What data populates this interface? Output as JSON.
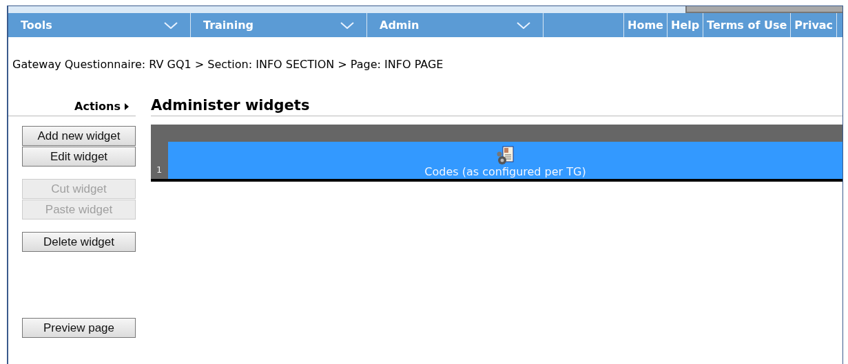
{
  "nav": {
    "menus": [
      {
        "label": "Tools"
      },
      {
        "label": "Training"
      },
      {
        "label": "Admin"
      }
    ],
    "links": [
      {
        "label": "Home"
      },
      {
        "label": "Help"
      },
      {
        "label": "Terms of Use"
      },
      {
        "label": "Privac"
      }
    ]
  },
  "breadcrumb": "Gateway Questionnaire: RV GQ1 > Section: INFO SECTION > Page: INFO PAGE",
  "sidebar": {
    "heading": "Actions",
    "groups": [
      {
        "buttons": [
          {
            "label": "Add new widget",
            "disabled": false
          },
          {
            "label": "Edit widget",
            "disabled": false
          }
        ]
      },
      {
        "buttons": [
          {
            "label": "Cut widget",
            "disabled": true
          },
          {
            "label": "Paste widget",
            "disabled": true
          }
        ]
      },
      {
        "buttons": [
          {
            "label": "Delete widget",
            "disabled": false
          }
        ]
      },
      {
        "buttons": [
          {
            "label": "Preview page",
            "disabled": false
          }
        ]
      }
    ]
  },
  "title": "Administer widgets",
  "widgets": [
    {
      "number": "1",
      "label": "Codes (as configured per TG)",
      "selected": true
    }
  ]
}
